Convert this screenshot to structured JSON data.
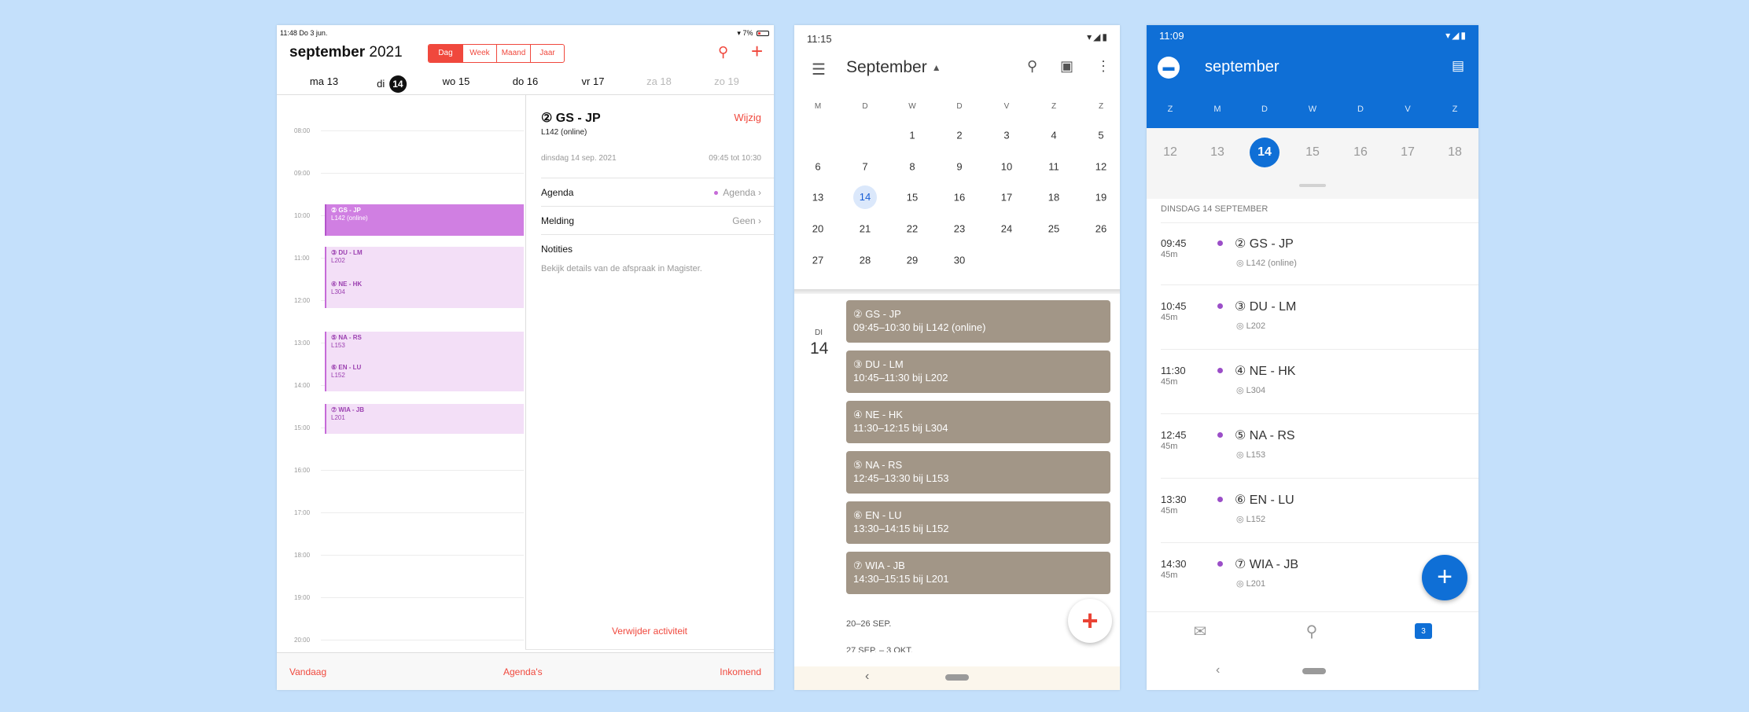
{
  "ipad": {
    "status_left": "11:48  Do 3 jun.",
    "status_right": "7%",
    "title_month": "september",
    "title_year": "2021",
    "segments": [
      "Dag",
      "Week",
      "Maand",
      "Jaar"
    ],
    "days": [
      {
        "label": "ma 13",
        "muted": false
      },
      {
        "label": "di",
        "num": "14",
        "muted": false
      },
      {
        "label": "wo 15",
        "muted": false
      },
      {
        "label": "do 16",
        "muted": false
      },
      {
        "label": "vr 17",
        "muted": false
      },
      {
        "label": "za 18",
        "muted": true
      },
      {
        "label": "zo 19",
        "muted": true
      }
    ],
    "hours": [
      "08:00",
      "09:00",
      "10:00",
      "11:00",
      "12:00",
      "13:00",
      "14:00",
      "15:00",
      "16:00",
      "17:00",
      "18:00",
      "19:00",
      "20:00"
    ],
    "events": [
      {
        "title": "② GS - JP",
        "loc": "L142 (online)",
        "selected": true
      },
      {
        "title": "③ DU - LM",
        "loc": "L202",
        "selected": false
      },
      {
        "title": "④ NE - HK",
        "loc": "L304",
        "selected": false
      },
      {
        "title": "⑤ NA - RS",
        "loc": "L153",
        "selected": false
      },
      {
        "title": "⑥ EN - LU",
        "loc": "L152",
        "selected": false
      },
      {
        "title": "⑦ WIA - JB",
        "loc": "L201",
        "selected": false
      }
    ],
    "detail": {
      "title": "② GS - JP",
      "subtitle": "L142 (online)",
      "edit": "Wijzig",
      "date": "dinsdag 14 sep. 2021",
      "time": "09:45 tot 10:30",
      "agenda_label": "Agenda",
      "agenda_value": "Agenda",
      "melding_label": "Melding",
      "melding_value": "Geen",
      "notes_label": "Notities",
      "notes_text": "Bekijk details van de afspraak in Magister.",
      "delete": "Verwijder activiteit"
    },
    "footer": {
      "today": "Vandaag",
      "agendas": "Agenda's",
      "inbox": "Inkomend"
    },
    "accent": "#f0483d"
  },
  "gcal": {
    "status_time": "11:15",
    "month": "September",
    "weekdays": [
      "M",
      "D",
      "W",
      "D",
      "V",
      "Z",
      "Z"
    ],
    "weeks": [
      [
        "",
        "",
        "1",
        "2",
        "3",
        "4",
        "5"
      ],
      [
        "6",
        "7",
        "8",
        "9",
        "10",
        "11",
        "12"
      ],
      [
        "13",
        "14",
        "15",
        "16",
        "17",
        "18",
        "19"
      ],
      [
        "20",
        "21",
        "22",
        "23",
        "24",
        "25",
        "26"
      ],
      [
        "27",
        "28",
        "29",
        "30",
        "",
        "",
        ""
      ]
    ],
    "today": "14",
    "day_dow": "DI",
    "day_num": "14",
    "events": [
      {
        "title": "② GS - JP",
        "detail": "09:45–10:30 bij L142 (online)"
      },
      {
        "title": "③ DU - LM",
        "detail": "10:45–11:30 bij L202"
      },
      {
        "title": "④ NE - HK",
        "detail": "11:30–12:15 bij L304"
      },
      {
        "title": "⑤ NA - RS",
        "detail": "12:45–13:30 bij L153"
      },
      {
        "title": "⑥ EN - LU",
        "detail": "13:30–14:15 bij L152"
      },
      {
        "title": "⑦ WIA - JB",
        "detail": "14:30–15:15 bij L201"
      }
    ],
    "next_week": "20–26 SEP.",
    "next_week2": "27 SEP. – 3 OKT.",
    "event_color": "#a29687"
  },
  "outlook": {
    "status_time": "11:09",
    "title": "september",
    "weekdays": [
      "Z",
      "M",
      "D",
      "W",
      "D",
      "V",
      "Z"
    ],
    "days": [
      "12",
      "13",
      "14",
      "15",
      "16",
      "17",
      "18"
    ],
    "selected": "14",
    "day_label": "DINSDAG 14 SEPTEMBER",
    "events": [
      {
        "time": "09:45",
        "dur": "45m",
        "title": "② GS - JP",
        "loc": "L142 (online)"
      },
      {
        "time": "10:45",
        "dur": "45m",
        "title": "③ DU - LM",
        "loc": "L202"
      },
      {
        "time": "11:30",
        "dur": "45m",
        "title": "④ NE - HK",
        "loc": "L304"
      },
      {
        "time": "12:45",
        "dur": "45m",
        "title": "⑤ NA - RS",
        "loc": "L153"
      },
      {
        "time": "13:30",
        "dur": "45m",
        "title": "⑥ EN - LU",
        "loc": "L152"
      },
      {
        "time": "14:30",
        "dur": "45m",
        "title": "⑦ WIA - JB",
        "loc": "L201"
      }
    ],
    "accent": "#0f6fd6"
  }
}
